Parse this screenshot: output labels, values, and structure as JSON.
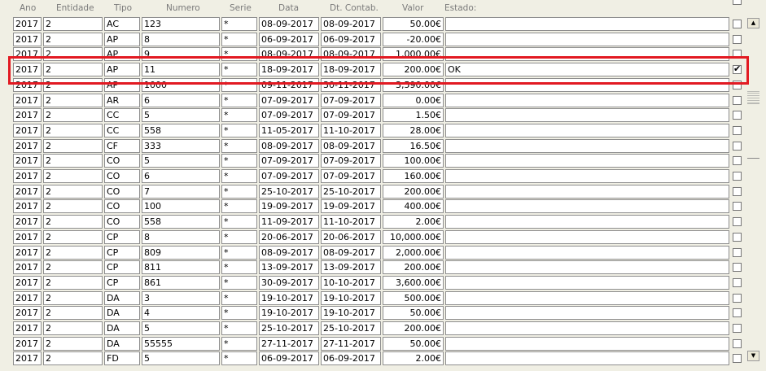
{
  "columns": {
    "ano": "Ano",
    "entidade": "Entidade",
    "tipo": "Tipo",
    "numero": "Numero",
    "serie": "Serie",
    "data": "Data",
    "dt_contab": "Dt. Contab.",
    "valor": "Valor",
    "estado": "Estado:"
  },
  "rows": [
    {
      "ano": "2017",
      "entidade": "2",
      "tipo": "AC",
      "numero": "123",
      "serie": "*",
      "data": "08-09-2017",
      "dt_contab": "08-09-2017",
      "valor": "50.00€",
      "estado": "",
      "checked": false
    },
    {
      "ano": "2017",
      "entidade": "2",
      "tipo": "AP",
      "numero": "8",
      "serie": "*",
      "data": "06-09-2017",
      "dt_contab": "06-09-2017",
      "valor": "-20.00€",
      "estado": "",
      "checked": false
    },
    {
      "ano": "2017",
      "entidade": "2",
      "tipo": "AP",
      "numero": "9",
      "serie": "*",
      "data": "08-09-2017",
      "dt_contab": "08-09-2017",
      "valor": "1,000.00€",
      "estado": "",
      "checked": false
    },
    {
      "ano": "2017",
      "entidade": "2",
      "tipo": "AP",
      "numero": "11",
      "serie": "*",
      "data": "18-09-2017",
      "dt_contab": "18-09-2017",
      "valor": "200.00€",
      "estado": "OK",
      "checked": true
    },
    {
      "ano": "2017",
      "entidade": "2",
      "tipo": "AP",
      "numero": "1000",
      "serie": "*",
      "data": "09-11-2017",
      "dt_contab": "30-11-2017",
      "valor": "3,590.00€",
      "estado": "",
      "checked": false
    },
    {
      "ano": "2017",
      "entidade": "2",
      "tipo": "AR",
      "numero": "6",
      "serie": "*",
      "data": "07-09-2017",
      "dt_contab": "07-09-2017",
      "valor": "0.00€",
      "estado": "",
      "checked": false
    },
    {
      "ano": "2017",
      "entidade": "2",
      "tipo": "CC",
      "numero": "5",
      "serie": "*",
      "data": "07-09-2017",
      "dt_contab": "07-09-2017",
      "valor": "1.50€",
      "estado": "",
      "checked": false
    },
    {
      "ano": "2017",
      "entidade": "2",
      "tipo": "CC",
      "numero": "558",
      "serie": "*",
      "data": "11-05-2017",
      "dt_contab": "11-10-2017",
      "valor": "28.00€",
      "estado": "",
      "checked": false
    },
    {
      "ano": "2017",
      "entidade": "2",
      "tipo": "CF",
      "numero": "333",
      "serie": "*",
      "data": "08-09-2017",
      "dt_contab": "08-09-2017",
      "valor": "16.50€",
      "estado": "",
      "checked": false
    },
    {
      "ano": "2017",
      "entidade": "2",
      "tipo": "CO",
      "numero": "5",
      "serie": "*",
      "data": "07-09-2017",
      "dt_contab": "07-09-2017",
      "valor": "100.00€",
      "estado": "",
      "checked": false
    },
    {
      "ano": "2017",
      "entidade": "2",
      "tipo": "CO",
      "numero": "6",
      "serie": "*",
      "data": "07-09-2017",
      "dt_contab": "07-09-2017",
      "valor": "160.00€",
      "estado": "",
      "checked": false
    },
    {
      "ano": "2017",
      "entidade": "2",
      "tipo": "CO",
      "numero": "7",
      "serie": "*",
      "data": "25-10-2017",
      "dt_contab": "25-10-2017",
      "valor": "200.00€",
      "estado": "",
      "checked": false
    },
    {
      "ano": "2017",
      "entidade": "2",
      "tipo": "CO",
      "numero": "100",
      "serie": "*",
      "data": "19-09-2017",
      "dt_contab": "19-09-2017",
      "valor": "400.00€",
      "estado": "",
      "checked": false
    },
    {
      "ano": "2017",
      "entidade": "2",
      "tipo": "CO",
      "numero": "558",
      "serie": "*",
      "data": "11-09-2017",
      "dt_contab": "11-10-2017",
      "valor": "2.00€",
      "estado": "",
      "checked": false
    },
    {
      "ano": "2017",
      "entidade": "2",
      "tipo": "CP",
      "numero": "8",
      "serie": "*",
      "data": "20-06-2017",
      "dt_contab": "20-06-2017",
      "valor": "10,000.00€",
      "estado": "",
      "checked": false
    },
    {
      "ano": "2017",
      "entidade": "2",
      "tipo": "CP",
      "numero": "809",
      "serie": "*",
      "data": "08-09-2017",
      "dt_contab": "08-09-2017",
      "valor": "2,000.00€",
      "estado": "",
      "checked": false
    },
    {
      "ano": "2017",
      "entidade": "2",
      "tipo": "CP",
      "numero": "811",
      "serie": "*",
      "data": "13-09-2017",
      "dt_contab": "13-09-2017",
      "valor": "200.00€",
      "estado": "",
      "checked": false
    },
    {
      "ano": "2017",
      "entidade": "2",
      "tipo": "CP",
      "numero": "861",
      "serie": "*",
      "data": "30-09-2017",
      "dt_contab": "10-10-2017",
      "valor": "3,600.00€",
      "estado": "",
      "checked": false
    },
    {
      "ano": "2017",
      "entidade": "2",
      "tipo": "DA",
      "numero": "3",
      "serie": "*",
      "data": "19-10-2017",
      "dt_contab": "19-10-2017",
      "valor": "500.00€",
      "estado": "",
      "checked": false
    },
    {
      "ano": "2017",
      "entidade": "2",
      "tipo": "DA",
      "numero": "4",
      "serie": "*",
      "data": "19-10-2017",
      "dt_contab": "19-10-2017",
      "valor": "50.00€",
      "estado": "",
      "checked": false
    },
    {
      "ano": "2017",
      "entidade": "2",
      "tipo": "DA",
      "numero": "5",
      "serie": "*",
      "data": "25-10-2017",
      "dt_contab": "25-10-2017",
      "valor": "200.00€",
      "estado": "",
      "checked": false
    },
    {
      "ano": "2017",
      "entidade": "2",
      "tipo": "DA",
      "numero": "55555",
      "serie": "*",
      "data": "27-11-2017",
      "dt_contab": "27-11-2017",
      "valor": "50.00€",
      "estado": "",
      "checked": false
    },
    {
      "ano": "2017",
      "entidade": "2",
      "tipo": "FD",
      "numero": "5",
      "serie": "*",
      "data": "06-09-2017",
      "dt_contab": "06-09-2017",
      "valor": "2.00€",
      "estado": "",
      "checked": false
    }
  ],
  "scrollbar": {
    "up_icon": "arrow-up-icon",
    "down_icon": "arrow-down-icon"
  },
  "colors": {
    "highlight": "#e21a22",
    "background": "#f0efe4",
    "field_border": "#8e8e8e"
  }
}
